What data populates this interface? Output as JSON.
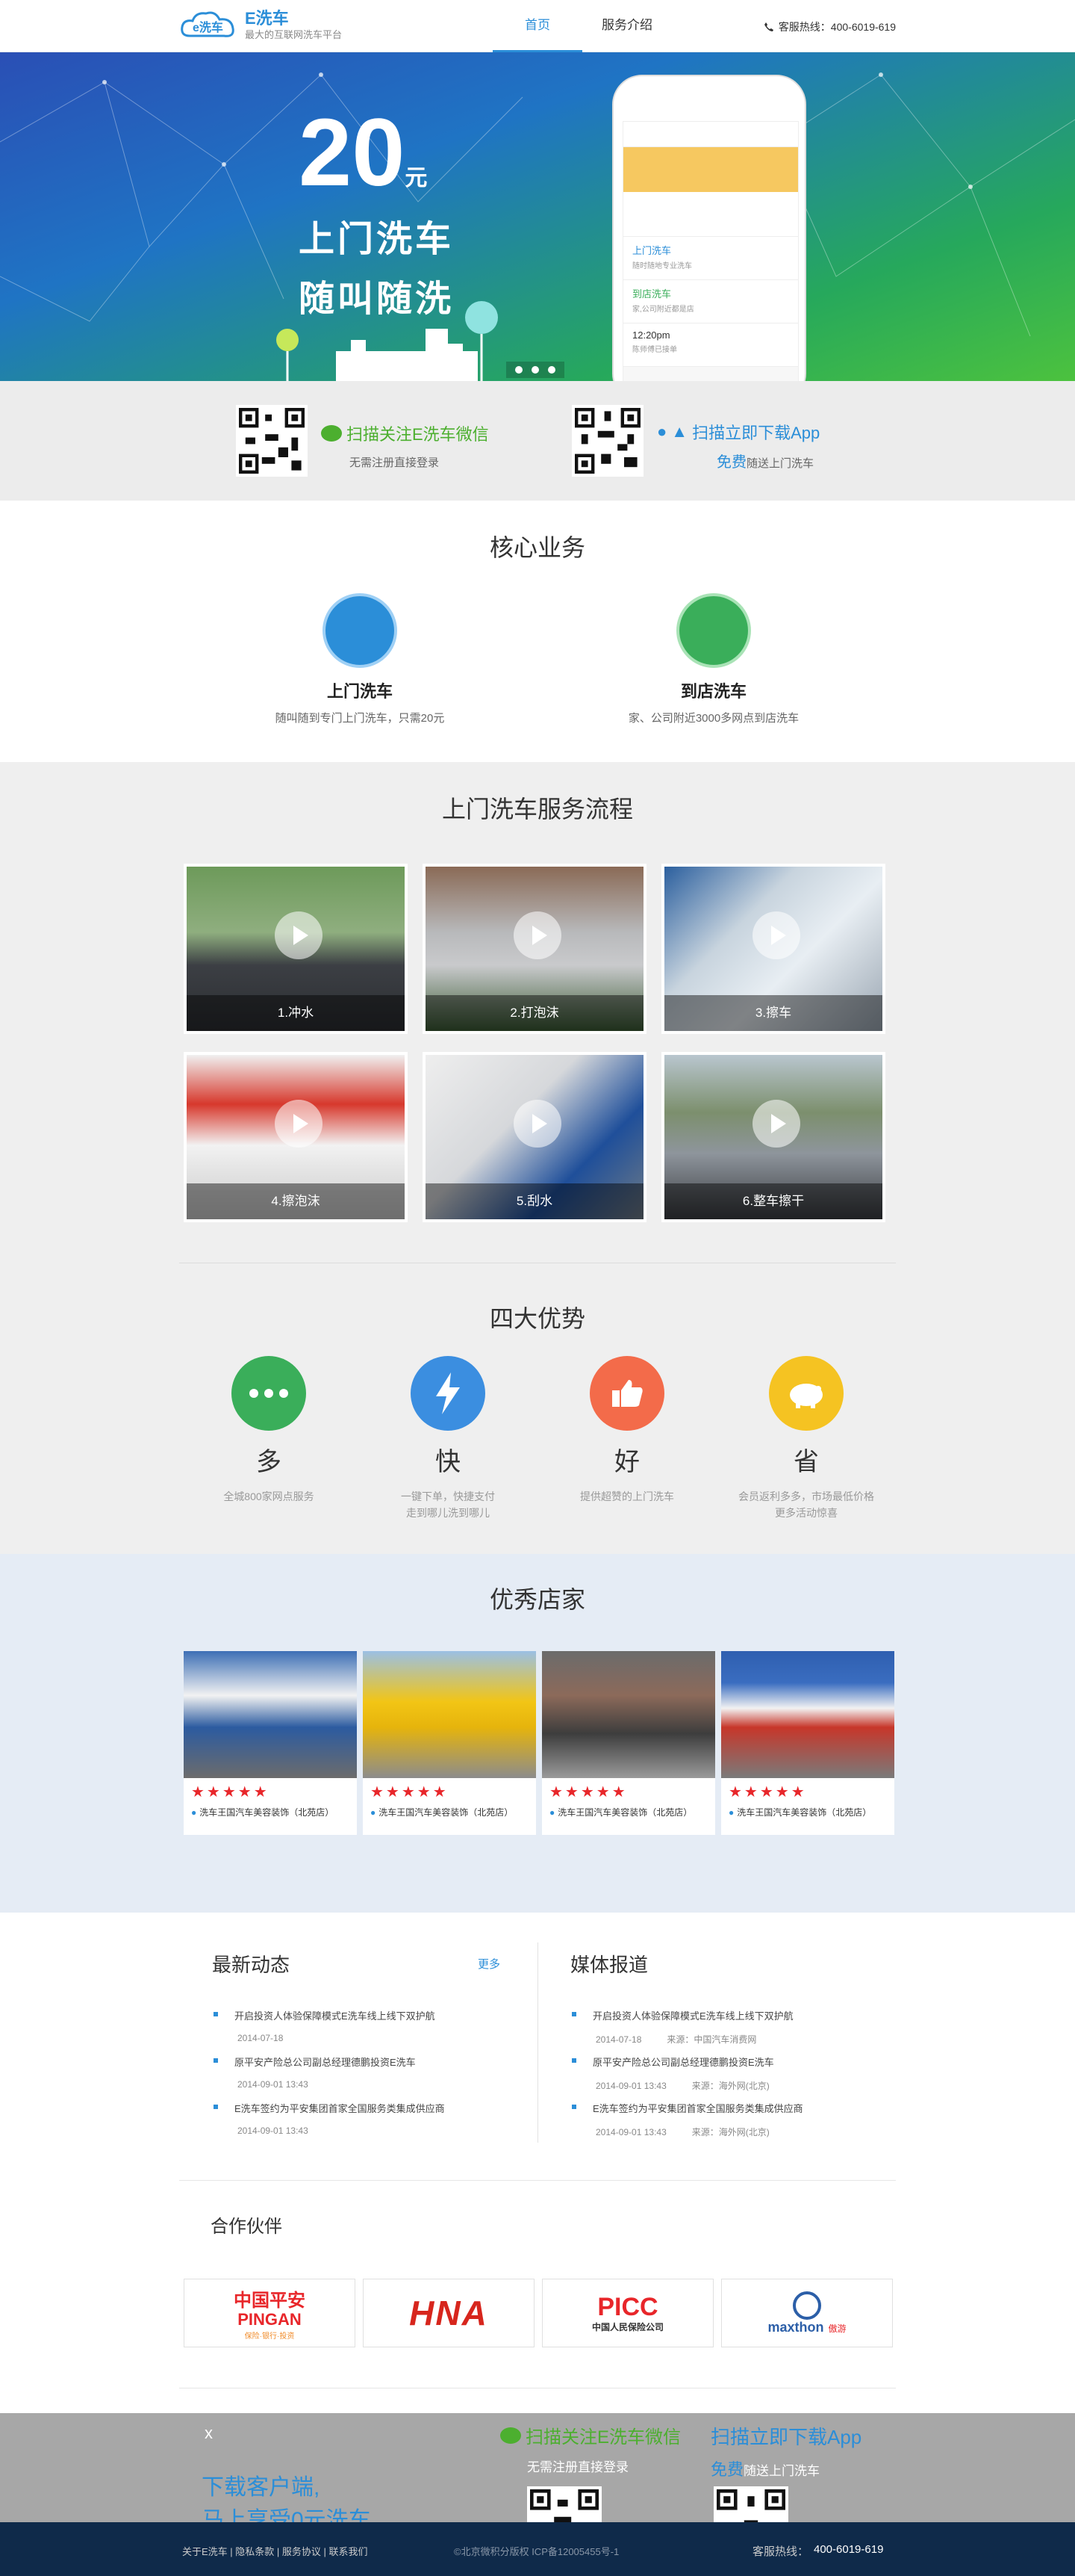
{
  "header": {
    "brand": "E洗车",
    "slogan": "最大的互联网洗车平台",
    "nav": [
      "首页",
      "服务介绍"
    ],
    "hotline": "客服热线：400-6019-619"
  },
  "banner": {
    "price": "20",
    "unit": "元",
    "line1": "上门洗车",
    "line2": "随叫随洗",
    "phone_items": [
      {
        "title": "上门洗车",
        "sub": "随时随地专业洗车"
      },
      {
        "title": "到店洗车",
        "sub": "家,公司附近都是店"
      },
      {
        "title": "12:20pm",
        "sub": "陈师傅已接单"
      }
    ]
  },
  "qr_strip": {
    "wechat_title": "扫描关注E洗车微信",
    "wechat_sub": "无需注册直接登录",
    "app_title": "扫描立即下载App",
    "app_sub_strong": "免费",
    "app_sub": "随送上门洗车"
  },
  "core": {
    "title": "核心业务",
    "items": [
      {
        "name": "上门洗车",
        "desc": "随叫随到专门上门洗车，只需20元"
      },
      {
        "name": "到店洗车",
        "desc": "家、公司附近3000多网点到店洗车"
      }
    ]
  },
  "process": {
    "title": "上门洗车服务流程",
    "steps": [
      "1.冲水",
      "2.打泡沫",
      "3.擦车",
      "4.擦泡沫",
      "5.刮水",
      "6.整车擦干"
    ]
  },
  "advantages": {
    "title": "四大优势",
    "items": [
      {
        "word": "多",
        "desc": "全城800家网点服务",
        "desc2": "",
        "color": "#3aae5a"
      },
      {
        "word": "快",
        "desc": "一键下单，快捷支付",
        "desc2": "走到哪儿洗到哪儿",
        "color": "#3b8ee0"
      },
      {
        "word": "好",
        "desc": "提供超赞的上门洗车",
        "desc2": "",
        "color": "#f36b4a"
      },
      {
        "word": "省",
        "desc": "会员返利多多，市场最低价格",
        "desc2": "更多活动惊喜",
        "color": "#f5c322"
      }
    ]
  },
  "stores": {
    "title": "优秀店家",
    "items": [
      {
        "stars": "★★★★★",
        "name": "洗车王国汽车美容装饰（北苑店）"
      },
      {
        "stars": "★★★★★",
        "name": "洗车王国汽车美容装饰（北苑店）"
      },
      {
        "stars": "★★★★★",
        "name": "洗车王国汽车美容装饰（北苑店）"
      },
      {
        "stars": "★★★★★",
        "name": "洗车王国汽车美容装饰（北苑店）"
      }
    ]
  },
  "news": {
    "title": "最新动态",
    "more": "更多",
    "items": [
      {
        "title": "开启投资人体验保障模式E洗车线上线下双护航",
        "date": "2014-07-18"
      },
      {
        "title": "原平安产险总公司副总经理德鹏投资E洗车",
        "date": "2014-09-01 13:43"
      },
      {
        "title": "E洗车签约为平安集团首家全国服务类集成供应商",
        "date": "2014-09-01 13:43"
      }
    ]
  },
  "media": {
    "title": "媒体报道",
    "items": [
      {
        "title": "开启投资人体验保障模式E洗车线上线下双护航",
        "date": "2014-07-18",
        "source": "来源：中国汽车消费网"
      },
      {
        "title": "原平安产险总公司副总经理德鹏投资E洗车",
        "date": "2014-09-01 13:43",
        "source": "来源：海外网(北京)"
      },
      {
        "title": "E洗车签约为平安集团首家全国服务类集成供应商",
        "date": "2014-09-01 13:43",
        "source": "来源：海外网(北京)"
      }
    ]
  },
  "partners": {
    "title": "合作伙伴",
    "items": [
      {
        "name": "中国平安",
        "sub": "PINGAN",
        "tag": "保险·银行·投资"
      },
      {
        "name": "HNA",
        "sub": "",
        "tag": ""
      },
      {
        "name": "PICC",
        "sub": "中国人民保险公司",
        "tag": ""
      },
      {
        "name": "maxthon",
        "sub": "傲游",
        "tag": ""
      }
    ]
  },
  "float_bar": {
    "close": "x",
    "download_line1": "下载客户端,",
    "download_line2": "马上享受0元洗车",
    "wechat_title": "扫描关注E洗车微信",
    "wechat_sub": "无需注册直接登录",
    "app_title": "扫描立即下载App",
    "app_sub_strong": "免费",
    "app_sub": "随送上门洗车"
  },
  "footer": {
    "links": "关于E洗车 | 隐私条款 | 服务协议 | 联系我们",
    "copyright": "©北京微积分版权 ICP备12005455号-1",
    "hotline_label": "客服热线：",
    "hotline": "400-6019-619"
  }
}
